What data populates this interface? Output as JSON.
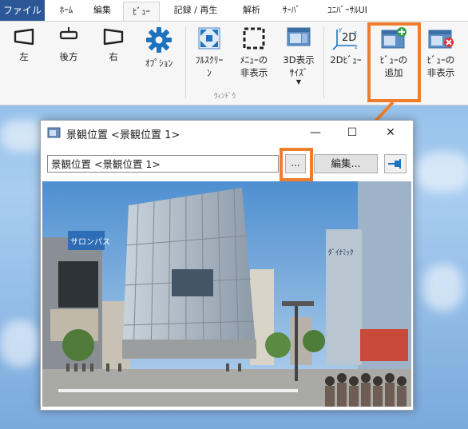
{
  "tabs": [
    {
      "label": "ファイル"
    },
    {
      "label": "ﾎｰﾑ"
    },
    {
      "label": "編集"
    },
    {
      "label": "ﾋﾞｭｰ"
    },
    {
      "label": "記録 / 再生"
    },
    {
      "label": "解析"
    },
    {
      "label": "ｻｰﾊﾞ"
    },
    {
      "label": "ﾕﾆﾊﾞｰｻﾙUI"
    }
  ],
  "ribbon": {
    "buttons": [
      {
        "label": "左"
      },
      {
        "label": "後方"
      },
      {
        "label": "右"
      },
      {
        "label": "ｵﾌﾟｼｮﾝ"
      },
      {
        "label": "ﾌﾙｽｸﾘｰ\nﾝ"
      },
      {
        "label": "ﾒﾆｭｰの\n非表示"
      },
      {
        "label": "3D表示\nｻｲｽﾞ"
      },
      {
        "label": "2Dﾋﾞｭｰ"
      },
      {
        "label": "ﾋﾞｭｰの\n追加"
      },
      {
        "label": "ﾋﾞｭｰの\n非表示"
      }
    ],
    "group_label": "ｳｨﾝﾄﾞｳ",
    "icon_2d_text": "2D",
    "icon_xyz": [
      "x",
      "y",
      "z"
    ]
  },
  "window": {
    "title": "景観位置 <景観位置 1>",
    "minimize": "—",
    "maximize": "☐",
    "close": "✕",
    "combo_value": "景観位置 <景観位置 1>",
    "dots_label": "...",
    "edit_label": "編集..."
  },
  "scene": {
    "signs": [
      "サロンパス",
      "ﾀﾞｲﾅﾐｯｸ"
    ]
  },
  "colors": {
    "accent": "#ee7e2d",
    "file_tab": "#2b5797",
    "icon_blue": "#1e73be"
  }
}
